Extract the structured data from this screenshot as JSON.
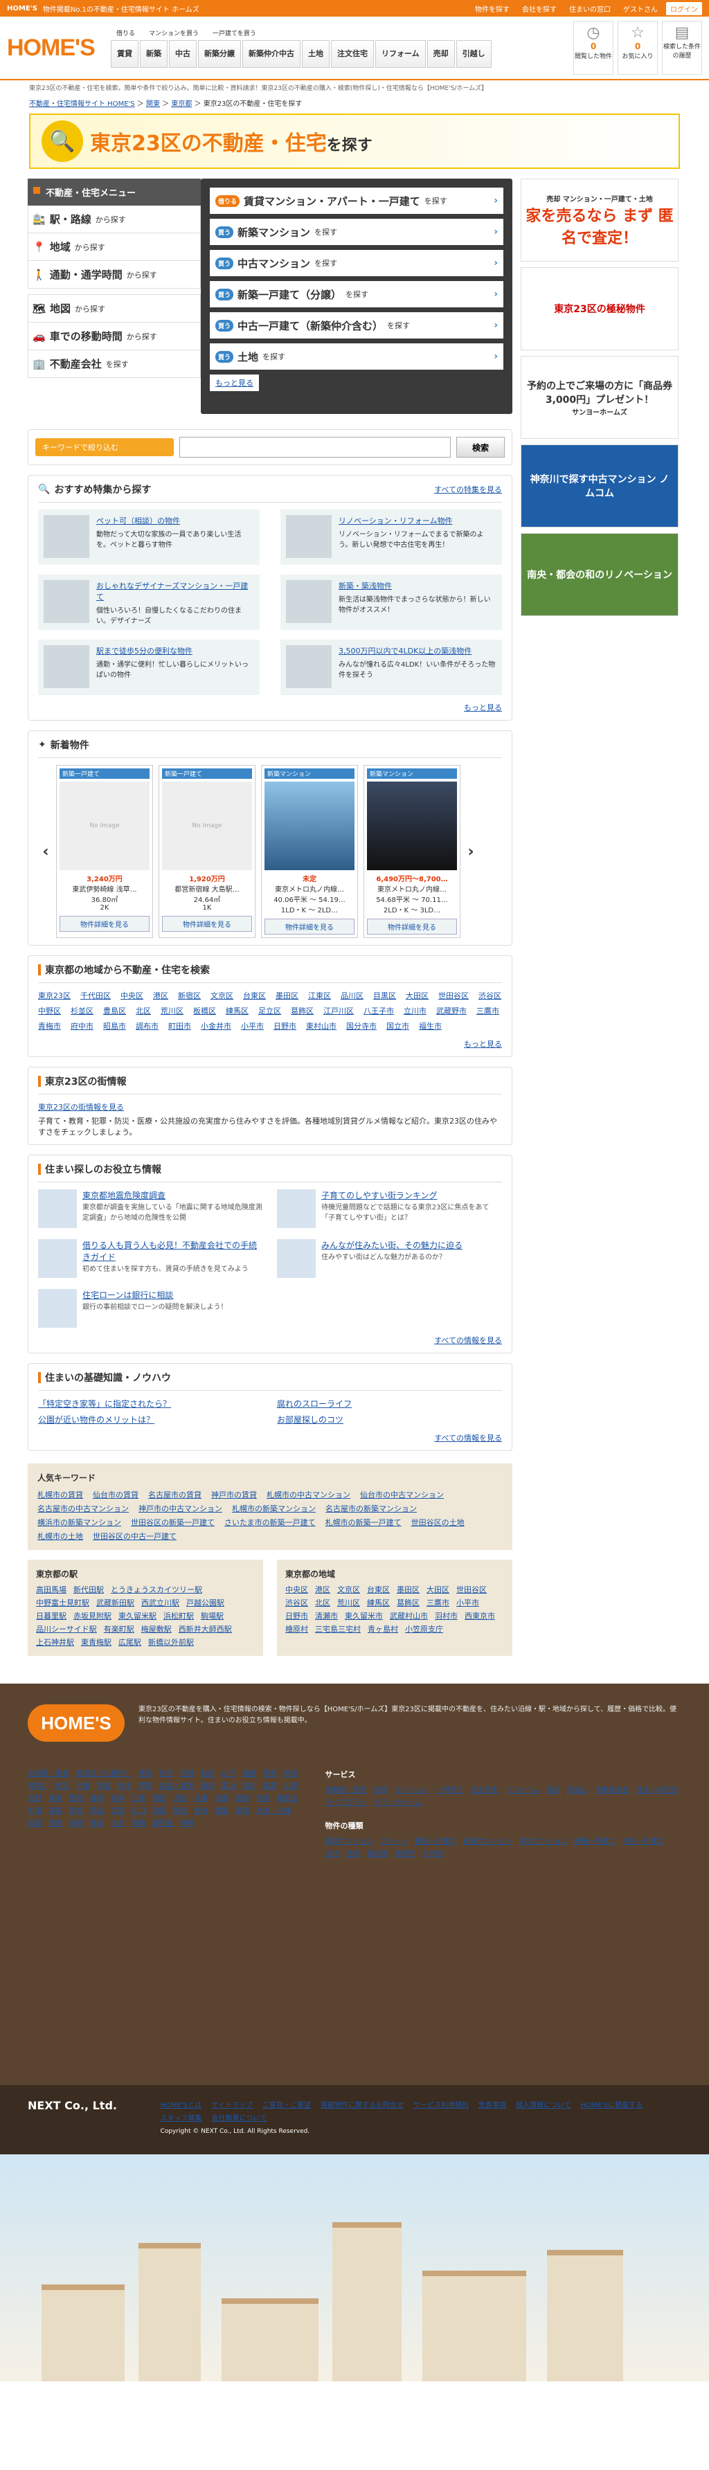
{
  "topbar": {
    "brand": "HOME'S",
    "tagline": "物件掲載No.1の不動産・住宅情報サイト ホームズ",
    "links": [
      "物件を探す",
      "会社を探す",
      "住まいの窓口",
      "ゲストさん",
      "ログイン"
    ]
  },
  "header": {
    "logo": "HOME'S",
    "nav_top": [
      "借りる",
      "マンションを買う",
      "一戸建てを買う"
    ],
    "nav": [
      "賃貸",
      "新築",
      "中古",
      "新築分譲",
      "新築仲介中古",
      "土地",
      "注文住宅",
      "リフォーム",
      "売却",
      "引越し"
    ],
    "icons": [
      {
        "label": "閲覧した物件",
        "count": "0"
      },
      {
        "label": "お気に入り",
        "count": "0"
      },
      {
        "label": "検索した条件の履歴",
        "count": ""
      }
    ]
  },
  "intro": "東京23区の不動産・住宅を検索。簡単や条件で絞り込み。簡単に比較・資料請求！東京23区の不動産の購入・検索(物件探し)・住宅情報なら【HOME'S/ホームズ】",
  "breadcrumb": [
    "不動産・住宅情報サイト HOME'S",
    "関東",
    "東京都",
    "東京23区の不動産・住宅を探す"
  ],
  "banner": {
    "title": "東京23区の不動産・住宅",
    "suffix": "を探す"
  },
  "menu": {
    "header": "不動産・住宅メニュー",
    "items": [
      {
        "label": "駅・路線",
        "sub": "から探す"
      },
      {
        "label": "地域",
        "sub": "から探す"
      },
      {
        "label": "通勤・通学時間",
        "sub": "から探す"
      }
    ],
    "items2": [
      {
        "label": "地図",
        "sub": "から探す"
      },
      {
        "label": "車での移動時間",
        "sub": "から探す"
      },
      {
        "label": "不動産会社",
        "sub": "を探す"
      }
    ]
  },
  "ptypes": [
    {
      "tag": "借りる",
      "label": "賃貸マンション・アパート・一戸建て",
      "sub": "を探す"
    },
    {
      "tag": "買う",
      "label": "新築マンション",
      "sub": "を探す"
    },
    {
      "tag": "買う",
      "label": "中古マンション",
      "sub": "を探す"
    },
    {
      "tag": "買う",
      "label": "新築一戸建て（分譲）",
      "sub": "を探す"
    },
    {
      "tag": "買う",
      "label": "中古一戸建て（新築仲介含む）",
      "sub": "を探す"
    },
    {
      "tag": "買う",
      "label": "土地",
      "sub": "を探す"
    }
  ],
  "ptypes_more": "もっと見る",
  "keyword": {
    "label": "キーワードで絞り込む",
    "placeholder": "",
    "button": "検索"
  },
  "featured": {
    "title": "おすすめ特集から探す",
    "all": "すべての特集を見る",
    "more": "もっと見る",
    "items": [
      {
        "t": "ペット可（相談）の物件",
        "d": "動物だって大切な家族の一員であり楽しい生活を。ペットと暮らす物件"
      },
      {
        "t": "リノベーション・リフォーム物件",
        "d": "リノベーション・リフォームでまるで新築のよう。新しい発想で中古住宅を再生！"
      },
      {
        "t": "おしゃれなデザイナーズマンション・一戸建て",
        "d": "個性いろいろ！自慢したくなるこだわりの住まい。デザイナーズ"
      },
      {
        "t": "新築・築浅物件",
        "d": "新生活は築浅物件でまっさらな状態から！新しい物件がオススメ！"
      },
      {
        "t": "駅まで徒歩5分の便利な物件",
        "d": "通勤・通学に便利！忙しい暮らしにメリットいっぱいの物件"
      },
      {
        "t": "3,500万円以内で4LDK以上の築浅物件",
        "d": "みんなが憧れる広々4LDK！いい条件がそろった物件を探そう"
      }
    ]
  },
  "newprops": {
    "title": "新着物件",
    "cards": [
      {
        "tag": "新築一戸建て",
        "img": "No Image",
        "price": "3,240万円",
        "name": "東武伊勢崎線 浅草…",
        "size": "36.80㎡",
        "plan": "2K",
        "btn": "物件詳細を見る"
      },
      {
        "tag": "新築一戸建て",
        "img": "No Image",
        "price": "1,920万円",
        "name": "都営新宿線 大島駅…",
        "size": "24.64㎡",
        "plan": "1K",
        "btn": "物件詳細を見る"
      },
      {
        "tag": "新築マンション",
        "img": "",
        "price": "未定",
        "name": "東京メトロ丸ノ内線…",
        "size": "40.06平米 ～ 54.19…",
        "plan": "1LD・K ～ 2LD…",
        "btn": "物件詳細を見る"
      },
      {
        "tag": "新築マンション",
        "img": "",
        "price": "6,490万円～8,700…",
        "name": "東京メトロ丸ノ内線…",
        "size": "54.68平米 ～ 70.11…",
        "plan": "2LD・K ～ 3LD…",
        "btn": "物件詳細を見る"
      }
    ]
  },
  "areas": {
    "title": "東京都の地域から不動産・住宅を検索",
    "more": "もっと見る",
    "list": [
      "東京23区",
      "千代田区",
      "中央区",
      "港区",
      "新宿区",
      "文京区",
      "台東区",
      "墨田区",
      "江東区",
      "品川区",
      "目黒区",
      "大田区",
      "世田谷区",
      "渋谷区",
      "中野区",
      "杉並区",
      "豊島区",
      "北区",
      "荒川区",
      "板橋区",
      "練馬区",
      "足立区",
      "葛飾区",
      "江戸川区",
      "八王子市",
      "立川市",
      "武蔵野市",
      "三鷹市",
      "青梅市",
      "府中市",
      "昭島市",
      "調布市",
      "町田市",
      "小金井市",
      "小平市",
      "日野市",
      "東村山市",
      "国分寺市",
      "国立市",
      "福生市"
    ]
  },
  "streets": {
    "title": "東京23区の街情報",
    "link": "東京23区の街情報を見る",
    "desc": "子育て・教育・犯罪・防災・医療・公共施設の充実度から住みやすさを評価。各種地域別賃貸グルメ情報など紹介。東京23区の住みやすさをチェックしましょう。"
  },
  "tips": {
    "title": "住まい探しのお役立ち情報",
    "all": "すべての情報を見る",
    "items": [
      {
        "t": "東京都地震危険度調査",
        "d": "東京都が調査を実施している「地震に関する地域危険度測定調査」から地域の危険性を公開"
      },
      {
        "t": "子育てのしやすい街ランキング",
        "d": "待機児童問題などで話題になる東京23区に焦点をあて「子育てしやすい街」とは？"
      },
      {
        "t": "借りる人も買う人も必見！不動産会社での手続きガイド",
        "d": "初めて住まいを探す方も、賃貸の手続きを見てみよう"
      },
      {
        "t": "みんなが住みたい街、その魅力に迫る",
        "d": "住みやすい街はどんな魅力があるのか？"
      },
      {
        "t": "住宅ローンは銀行に相談",
        "d": "銀行の事前相談でローンの疑問を解決しよう！"
      }
    ]
  },
  "knowledge": {
    "title": "住まいの基礎知識・ノウハウ",
    "all": "すべての情報を見る",
    "items": [
      "「特定空き家等」に指定されたら？",
      "腐れのスローライフ",
      "公園が近い物件のメリットは？",
      "お部屋探しのコツ"
    ]
  },
  "popular": {
    "title": "人気キーワード",
    "kws": [
      "札幌市の賃貸",
      "仙台市の賃貸",
      "名古屋市の賃貸",
      "神戸市の賃貸",
      "札幌市の中古マンション",
      "仙台市の中古マンション",
      "名古屋市の中古マンション",
      "神戸市の中古マンション",
      "札幌市の新築マンション",
      "名古屋市の新築マンション",
      "横浜市の新築マンション",
      "世田谷区の新築一戸建て",
      "さいたま市の新築一戸建て",
      "札幌市の新築一戸建て",
      "世田谷区の土地",
      "札幌市の土地",
      "世田谷区の中古一戸建て"
    ]
  },
  "stations": {
    "title": "東京都の駅",
    "list": [
      "高田馬場",
      "新代田駅",
      "とうきょうスカイツリー駅",
      "中野富士見町駅",
      "武蔵新田駅",
      "西武立川駅",
      "戸越公園駅",
      "日暮里駅",
      "赤坂見附駅",
      "東久留米駅",
      "浜松町駅",
      "駒場駅",
      "品川シーサイド駅",
      "有楽町駅",
      "梅屋敷駅",
      "西新井大師西駅",
      "上石神井駅",
      "東青梅駅",
      "広尾駅",
      "新橋以外前駅"
    ]
  },
  "tokyo_areas": {
    "title": "東京都の地域",
    "list": [
      "中央区",
      "港区",
      "文京区",
      "台東区",
      "墨田区",
      "大田区",
      "世田谷区",
      "渋谷区",
      "北区",
      "荒川区",
      "練馬区",
      "葛飾区",
      "三鷹市",
      "小平市",
      "日野市",
      "清瀬市",
      "東久留米市",
      "武蔵村山市",
      "羽村市",
      "西東京市",
      "檜原村",
      "三宅島三宅村",
      "青ヶ島村",
      "小笠原支庁"
    ]
  },
  "right": [
    {
      "t": "家を売るなら まず 匿名で査定！",
      "tag": "売却",
      "tag2": "マンション・一戸建て・土地"
    },
    {
      "t": "東京23区の極秘物件",
      "tag": "",
      "tag2": ""
    },
    {
      "t": "予約の上でご来場の方に「商品券3,000円」プレゼント！",
      "tag": "",
      "tag2": "サンヨーホームズ"
    },
    {
      "t": "神奈川で探す中古マンション ノムコム",
      "tag": "",
      "tag2": ""
    },
    {
      "t": "南央・都会の和のリノベーション",
      "tag": "",
      "tag2": ""
    }
  ],
  "footer": {
    "logo": "HOME'S",
    "desc": "東京23区の不動産を購入・住宅情報の検索・物件探しなら【HOME'S/ホームズ】東京23区に掲載中の不動産を、住みたい沿線・駅・地域から探して、履歴・価格で比較。便利な物件情報サイト。住まいのお役立ち情報も掲載中。",
    "area_head": "",
    "areas": [
      "北海道・東北",
      "北海道（札幌市）",
      "青森",
      "岩手",
      "宮城",
      "秋田",
      "山形",
      "福島",
      "関東",
      "東京",
      "神奈川",
      "埼玉",
      "千葉",
      "茨城",
      "栃木",
      "群馬",
      "信越・北陸",
      "新潟",
      "富山",
      "石川",
      "福井",
      "山梨",
      "長野",
      "東海",
      "愛知",
      "静岡",
      "岐阜",
      "三重",
      "関西",
      "大阪",
      "兵庫",
      "京都",
      "滋賀",
      "奈良",
      "和歌山",
      "中国",
      "鳥取",
      "島根",
      "岡山",
      "広島",
      "山口",
      "四国",
      "徳島",
      "香川",
      "愛媛",
      "高知",
      "九州・沖縄",
      "福岡",
      "佐賀",
      "長崎",
      "熊本",
      "大分",
      "宮崎",
      "鹿児島",
      "沖縄"
    ],
    "svc_head": "サービス",
    "svc": [
      "不動産・住宅",
      "賃貸",
      "マンション",
      "一戸建て",
      "注文住宅",
      "リフォーム",
      "売却",
      "引越し",
      "不動産会社",
      "住まいの窓口",
      "ライフプラン",
      "トランクルーム"
    ],
    "kind_head": "物件の種類",
    "kinds": [
      "賃貸マンション",
      "アパート",
      "賃貸一戸建て",
      "新築マンション",
      "中古マンション",
      "新築一戸建て",
      "中古一戸建て",
      "土地",
      "売地",
      "貸店舗",
      "事務所",
      "その他"
    ]
  },
  "bottom": {
    "company": "NEXT Co., Ltd.",
    "links": [
      "HOME'Sとは",
      "サイトマップ",
      "ご意見・ご要望",
      "掲載物件に関するお問合せ",
      "サービス利用規約",
      "免責事項",
      "個人情報について",
      "HOME'Sに掲載する",
      "スタッフ募集",
      "会社概要について"
    ],
    "copy": "Copyright © NEXT Co., Ltd. All Rights Reserved."
  }
}
